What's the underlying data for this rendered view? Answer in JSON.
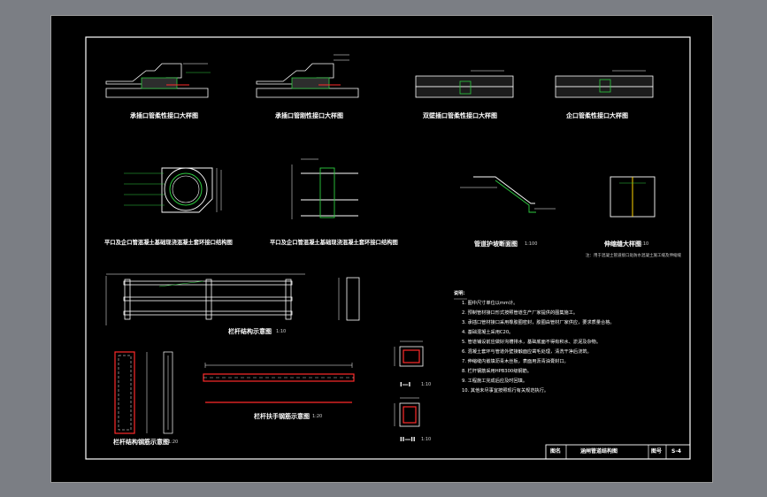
{
  "titles": {
    "t1": "承插口管柔性接口大样图",
    "t2": "承插口管刚性接口大样图",
    "t3": "双壁插口管柔性接口大样图",
    "t4": "企口管柔性接口大样图",
    "t5": "平口及企口管混凝土基础现浇混凝土套环接口结构图",
    "t6": "平口及企口管混凝土基础现浇混凝土套环接口结构图",
    "t7": "管道护坡断面图",
    "t7_scale": "1:100",
    "t8": "伸缩缝大样图",
    "t8_scale": "1:10",
    "t9": "栏杆结构示意图",
    "t9_scale": "1:10",
    "t10": "栏杆结构钢筋示意图",
    "t10_scale": "1:20",
    "t11": "栏杆扶手钢筋示意图",
    "t11_scale": "1:20",
    "t12": "I—I",
    "t12_scale": "1:10",
    "t13": "II—II",
    "t13_scale": "1:10"
  },
  "footnote_t8": "注：用于混凝土管道接口处防水混凝土施工缝及伸缩缝",
  "notes": {
    "heading": "说明：",
    "items": [
      "1. 图中尺寸单位以mm计。",
      "2. 预制管材接口形式按照管道生产厂家提供的图集施工。",
      "3. 承插口管材接口采用橡胶圈密封，胶圈由管材厂家供应，要求质量合格。",
      "4. 基础混凝土采用C20。",
      "5. 管道铺设前应做好沟槽排水，基础底面不得有积水、淤泥及杂物。",
      "6. 混凝土套环与管道外壁接触面应凿毛处理，清洗干净后浇筑。",
      "7. 伸缩缝内嵌填沥青木丝板，表面用沥青油膏封口。",
      "8. 栏杆钢筋采用HPB300级钢筋。",
      "9. 工程施工完成后应及时回填。",
      "10. 其他未尽事宜按照现行有关规范执行。"
    ]
  },
  "titleblock": {
    "label_name": "图名",
    "drawing_name": "涵闸管道结构图",
    "label_no": "图号",
    "drawing_no": "S-4"
  },
  "colors": {
    "sheet_bg": "#000000",
    "outer_bg": "#7b7e84",
    "line_white": "#ffffff",
    "line_green": "#2ecc40",
    "line_red": "#ff2a2a",
    "line_yellow": "#ffd400",
    "line_cyan": "#25c8d8"
  }
}
